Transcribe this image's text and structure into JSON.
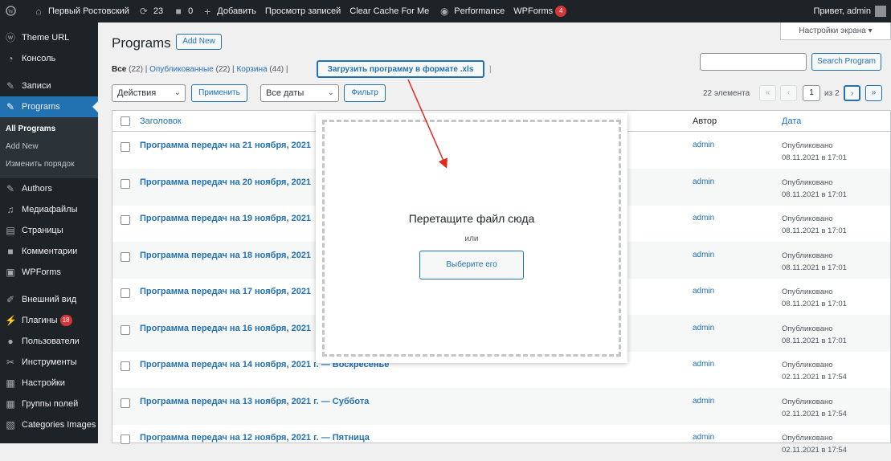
{
  "adminbar": {
    "site_name": "Первый Ростовский",
    "updates": "23",
    "comments": "0",
    "add_new": "Добавить",
    "view_posts": "Просмотр записей",
    "clear_cache": "Clear Cache For Me",
    "performance": "Performance",
    "wpforms": "WPForms",
    "wpforms_badge": "4",
    "greeting": "Привет, admin"
  },
  "sidebar": {
    "items": [
      {
        "label": "Theme URL",
        "icon": "wordpress-icon"
      },
      {
        "label": "Консоль",
        "icon": "gauge-icon"
      },
      {
        "label": "Записи",
        "icon": "pin-icon"
      },
      {
        "label": "Programs",
        "icon": "pin-icon"
      },
      {
        "label": "Authors",
        "icon": "pin-icon"
      },
      {
        "label": "Медиафайлы",
        "icon": "media-icon"
      },
      {
        "label": "Страницы",
        "icon": "page-icon"
      },
      {
        "label": "Комментарии",
        "icon": "comment-icon"
      },
      {
        "label": "WPForms",
        "icon": "form-icon"
      },
      {
        "label": "Внешний вид",
        "icon": "brush-icon"
      },
      {
        "label": "Плагины",
        "icon": "plugin-icon",
        "badge": "18"
      },
      {
        "label": "Пользователи",
        "icon": "user-icon"
      },
      {
        "label": "Инструменты",
        "icon": "wrench-icon"
      },
      {
        "label": "Настройки",
        "icon": "settings-icon"
      },
      {
        "label": "Группы полей",
        "icon": "grid-icon"
      },
      {
        "label": "Categories Images",
        "icon": "image-icon"
      }
    ],
    "submenu": [
      "All Programs",
      "Add New",
      "Изменить порядок"
    ]
  },
  "page": {
    "title": "Programs",
    "add_new": "Add New",
    "screen_options": "Настройки экрана ▾",
    "search_button": "Search Program",
    "filters": {
      "all": "Все",
      "all_count": "(22)",
      "published": "Опубликованные",
      "published_count": "(22)",
      "trash": "Корзина",
      "trash_count": "(44)",
      "upload_xls": "Загрузить программу в формате .xls"
    },
    "bulk_action": "Действия",
    "apply": "Применить",
    "dates": "Все даты",
    "filter": "Фильтр",
    "pagination": {
      "count": "22 элемента",
      "first": "«",
      "prev": "‹",
      "current": "1",
      "of": "из 2",
      "next": "›",
      "last": "»"
    },
    "columns": {
      "title": "Заголовок",
      "author": "Автор",
      "date": "Дата"
    }
  },
  "rows": [
    {
      "title": "Программа передач на 21 ноября, 2021",
      "author": "admin",
      "status": "Опубликовано",
      "date": "08.11.2021 в 17:01"
    },
    {
      "title": "Программа передач на 20 ноября, 2021",
      "author": "admin",
      "status": "Опубликовано",
      "date": "08.11.2021 в 17:01"
    },
    {
      "title": "Программа передач на 19 ноября, 2021",
      "author": "admin",
      "status": "Опубликовано",
      "date": "08.11.2021 в 17:01"
    },
    {
      "title": "Программа передач на 18 ноября, 2021",
      "author": "admin",
      "status": "Опубликовано",
      "date": "08.11.2021 в 17:01"
    },
    {
      "title": "Программа передач на 17 ноября, 2021",
      "author": "admin",
      "status": "Опубликовано",
      "date": "08.11.2021 в 17:01"
    },
    {
      "title": "Программа передач на 16 ноября, 2021",
      "author": "admin",
      "status": "Опубликовано",
      "date": "08.11.2021 в 17:01"
    },
    {
      "title": "Программа передач на 14 ноября, 2021 г. — Воскресенье",
      "author": "admin",
      "status": "Опубликовано",
      "date": "02.11.2021 в 17:54"
    },
    {
      "title": "Программа передач на 13 ноября, 2021 г. — Суббота",
      "author": "admin",
      "status": "Опубликовано",
      "date": "02.11.2021 в 17:54"
    },
    {
      "title": "Программа передач на 12 ноября, 2021 г. — Пятница",
      "author": "admin",
      "status": "Опубликовано",
      "date": "02.11.2021 в 17:54"
    }
  ],
  "dropzone": {
    "title": "Перетащите файл сюда",
    "or": "или",
    "choose": "Выберите его"
  },
  "colors": {
    "accent": "#2271b1",
    "admin_bg": "#1d2327",
    "arrow": "#e0281e"
  }
}
